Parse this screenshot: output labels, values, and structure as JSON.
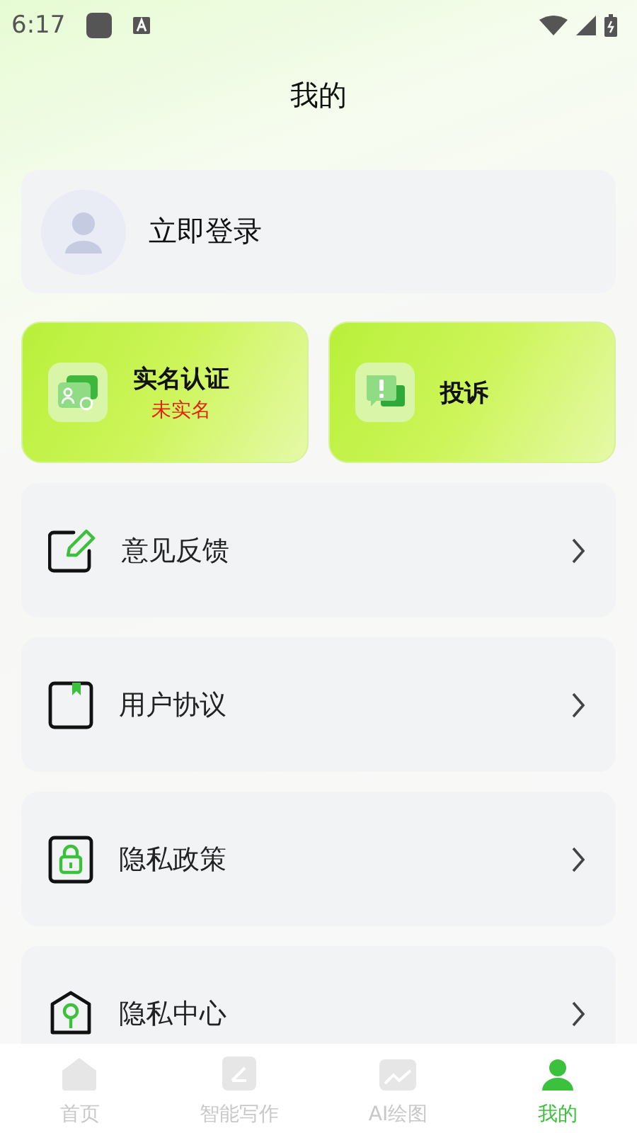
{
  "status_bar": {
    "time": "6:17"
  },
  "title": "我的",
  "login": {
    "label": "立即登录"
  },
  "actions": [
    {
      "kind": "verify",
      "title": "实名认证",
      "status": "未实名"
    },
    {
      "kind": "complaint",
      "title": "投诉"
    }
  ],
  "menu": [
    {
      "kind": "edit",
      "label": "意见反馈"
    },
    {
      "kind": "book",
      "label": "用户协议"
    },
    {
      "kind": "lock",
      "label": "隐私政策"
    },
    {
      "kind": "pin",
      "label": "隐私中心"
    }
  ],
  "tabs": [
    {
      "kind": "home",
      "label": "首页",
      "selected": false
    },
    {
      "kind": "write",
      "label": "智能写作",
      "selected": false
    },
    {
      "kind": "image",
      "label": "AI绘图",
      "selected": false
    },
    {
      "kind": "user",
      "label": "我的",
      "selected": true
    }
  ]
}
